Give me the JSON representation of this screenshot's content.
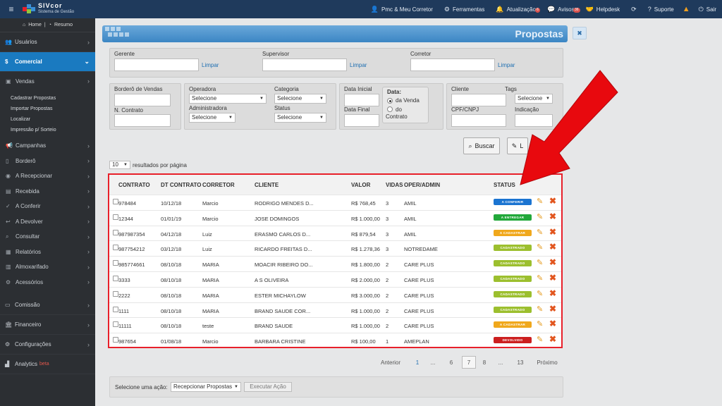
{
  "topbar": {
    "menu_icon": "hamburger-icon",
    "logo_title": "SIVcor",
    "logo_subtitle": "Sistema de Gestão",
    "items": [
      {
        "label": "Pmc & Meu Corretor",
        "icon": "user-icon"
      },
      {
        "label": "Ferramentas",
        "icon": "cogs-icon"
      },
      {
        "label": "Atualização",
        "icon": "bell-icon",
        "badge": "6"
      },
      {
        "label": "Avisos",
        "icon": "comments-icon",
        "badge": "36"
      },
      {
        "label": "Helpdesk",
        "icon": "handshake-icon"
      },
      {
        "label": "",
        "icon": "refresh-icon"
      },
      {
        "label": "Suporte",
        "icon": "question-icon"
      },
      {
        "label": "",
        "icon": "warning-icon"
      },
      {
        "label": "Sair",
        "icon": "power-icon"
      }
    ]
  },
  "sidebar": {
    "home_label": "Home",
    "resumo_label": "Resumo",
    "items": [
      {
        "label": "Usuários",
        "icon": "users-icon"
      },
      {
        "label": "Comercial",
        "icon": "dollar-icon",
        "active": true
      }
    ],
    "vendas": {
      "label": "Vendas",
      "links": [
        "Cadastrar Propostas",
        "Importar Propostas",
        "Localizar",
        "Impressão p/ Sorteio"
      ]
    },
    "subitems": [
      {
        "label": "Campanhas",
        "icon": "bullhorn-icon"
      },
      {
        "label": "Borderô",
        "icon": "file-icon"
      },
      {
        "label": "A Recepcionar",
        "icon": "eye-icon"
      },
      {
        "label": "Recebida",
        "icon": "book-icon"
      },
      {
        "label": "A Conferir",
        "icon": "check-icon"
      },
      {
        "label": "A Devolver",
        "icon": "reply-icon"
      },
      {
        "label": "Consultar",
        "icon": "search-icon"
      },
      {
        "label": "Relatórios",
        "icon": "report-icon"
      },
      {
        "label": "Almoxarifado",
        "icon": "box-icon"
      },
      {
        "label": "Acessórios",
        "icon": "cog-icon"
      }
    ],
    "bottom": [
      {
        "label": "Comissão",
        "icon": "money-icon"
      },
      {
        "label": "Financeiro",
        "icon": "bank-icon"
      },
      {
        "label": "Configurações",
        "icon": "cogs-icon"
      },
      {
        "label": "Analytics",
        "icon": "chart-icon",
        "tag": "beta"
      }
    ]
  },
  "page": {
    "title": "Propostas",
    "close_icon": "close-icon"
  },
  "filters": {
    "gerente_label": "Gerente",
    "supervisor_label": "Supervisor",
    "corretor_label": "Corretor",
    "limpar": "Limpar",
    "bordero_label": "Borderô de Vendas",
    "contrato_label": "N. Contrato",
    "operadora_label": "Operadora",
    "administradora_label": "Administradora",
    "categoria_label": "Categoria",
    "status_label": "Status",
    "selecione": "Selecione",
    "data_inicial_label": "Data Inicial",
    "data_final_label": "Data Final",
    "data_label": "Data:",
    "da_venda": "da Venda",
    "do_contrato_1": "do",
    "do_contrato_2": "Contrato",
    "cliente_label": "Cliente",
    "cpf_label": "CPF/CNPJ",
    "tags_label": "Tags",
    "indicacao_label": "Indicação"
  },
  "buttons": {
    "buscar": "Buscar",
    "limpar_partial": "L"
  },
  "results": {
    "per_page_value": "10",
    "per_page_label": "resultados por página"
  },
  "table": {
    "headers": [
      "CONTRATO",
      "DT CONTRATO",
      "CORRETOR",
      "CLIENTE",
      "VALOR",
      "VIDAS",
      "OPER/ADMIN",
      "STATUS"
    ],
    "rows": [
      {
        "contrato": "978484",
        "dt": "10/12/18",
        "corretor": "Marcio",
        "cliente": "RODRIGO MENDES D...",
        "valor": "R$ 768,45",
        "vidas": "3",
        "oper": "AMIL",
        "status": "A CONFERIR",
        "color": "#1b74d1"
      },
      {
        "contrato": "12344",
        "dt": "01/01/19",
        "corretor": "Marcio",
        "cliente": "JOSE DOMINGOS",
        "valor": "R$ 1.000,00",
        "vidas": "3",
        "oper": "AMIL",
        "status": "A ENTREGAR",
        "color": "#22a83a"
      },
      {
        "contrato": "987987354",
        "dt": "04/12/18",
        "corretor": "Luiz",
        "cliente": "ERASMO CARLOS D...",
        "valor": "R$ 879,54",
        "vidas": "3",
        "oper": "AMIL",
        "status": "A CADASTRAR",
        "color": "#f0a81c"
      },
      {
        "contrato": "987754212",
        "dt": "03/12/18",
        "corretor": "Luiz",
        "cliente": "RICARDO FREITAS D...",
        "valor": "R$ 1.278,36",
        "vidas": "3",
        "oper": "NOTREDAME",
        "status": "CADASTRADO",
        "color": "#9cbf2e"
      },
      {
        "contrato": "985774661",
        "dt": "08/10/18",
        "corretor": "MARIA",
        "cliente": "MOACIR RIBEIRO DO...",
        "valor": "R$ 1.800,00",
        "vidas": "2",
        "oper": "CARE PLUS",
        "status": "CADASTRADO",
        "color": "#9cbf2e"
      },
      {
        "contrato": "3333",
        "dt": "08/10/18",
        "corretor": "MARIA",
        "cliente": "A S OLIVEIRA",
        "valor": "R$ 2.000,00",
        "vidas": "2",
        "oper": "CARE PLUS",
        "status": "CADASTRADO",
        "color": "#9cbf2e"
      },
      {
        "contrato": "2222",
        "dt": "08/10/18",
        "corretor": "MARIA",
        "cliente": "ESTER MICHAYLOW",
        "valor": "R$ 3.000,00",
        "vidas": "2",
        "oper": "CARE PLUS",
        "status": "CADASTRADO",
        "color": "#9cbf2e"
      },
      {
        "contrato": "1111",
        "dt": "08/10/18",
        "corretor": "MARIA",
        "cliente": "BRAND SAUDE COR...",
        "valor": "R$ 1.000,00",
        "vidas": "2",
        "oper": "CARE PLUS",
        "status": "CADASTRADO",
        "color": "#9cbf2e"
      },
      {
        "contrato": "11111",
        "dt": "08/10/18",
        "corretor": "teste",
        "cliente": "BRAND SAUDE",
        "valor": "R$ 1.000,00",
        "vidas": "2",
        "oper": "CARE PLUS",
        "status": "A CADASTRAR",
        "color": "#f0a81c"
      },
      {
        "contrato": "987654",
        "dt": "01/08/18",
        "corretor": "Marcio",
        "cliente": "BARBARA CRISTINE",
        "valor": "R$ 100,00",
        "vidas": "1",
        "oper": "AMEPLAN",
        "status": "DEVOLVIDO",
        "color": "#cc1f1f"
      }
    ]
  },
  "pagination": {
    "prev": "Anterior",
    "pages": [
      "1",
      "...",
      "6",
      "7",
      "8",
      "...",
      "13"
    ],
    "current": "7",
    "next": "Próximo"
  },
  "action_bar": {
    "label": "Selecione uma ação:",
    "selected": "Recepcionar Propostas",
    "button": "Executar Ação"
  },
  "colors": {
    "topbar": "#1f3a5c",
    "sidebar": "#2c2f33",
    "active": "#1a7ac0",
    "highlight": "#e8202a"
  }
}
